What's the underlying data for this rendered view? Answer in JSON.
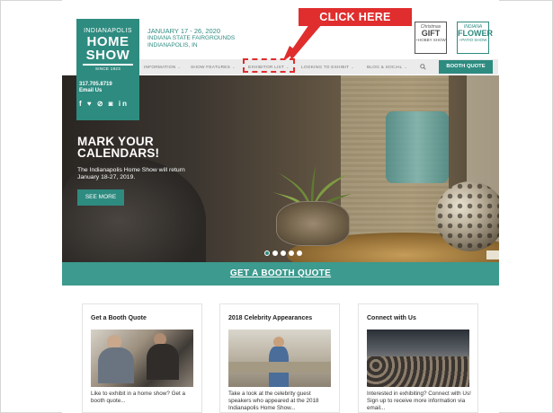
{
  "header": {
    "logo": {
      "line1": "INDIANAPOLIS",
      "line2": "HOME",
      "line3": "SHOW",
      "line4": "SINCE 1923"
    },
    "contact": {
      "phone": "317.705.8719",
      "email": "Email Us"
    },
    "socials": "f  ♥  ⊘  ◙  in",
    "event": {
      "date": "JANUARY 17 - 26, 2020",
      "venue": "INDIANA STATE FAIRGROUNDS",
      "city": "INDIANAPOLIS, IN"
    },
    "annotation": "CLICK HERE",
    "partners": [
      {
        "top": "Christmas",
        "mid": "GIFT",
        "bottom": "+HOBBY SHOW"
      },
      {
        "top": "INDIANA",
        "mid": "FLOWER",
        "bottom": "+PATIO SHOW"
      }
    ]
  },
  "nav": {
    "items": [
      {
        "label": "INFORMATION"
      },
      {
        "label": "SHOW FEATURES"
      },
      {
        "label": "EXHIBITOR LIST"
      },
      {
        "label": "LOOKING TO EXHIBIT"
      },
      {
        "label": "BLOG & SOCIAL"
      }
    ],
    "search_icon": "search-icon",
    "cta": "BOOTH QUOTE"
  },
  "hero": {
    "title_line1": "MARK YOUR",
    "title_line2": "CALENDARS!",
    "text_line1": "The Indianapolis Home Show will return",
    "text_line2": "January 18-27, 2019.",
    "button": "SEE MORE",
    "slides_total": 5,
    "active_slide": 1
  },
  "quote_bar": {
    "label": "GET A BOOTH QUOTE"
  },
  "cards": [
    {
      "title": "Get a Booth Quote",
      "text": "Like to exhibit in a home show? Get a booth quote..."
    },
    {
      "title": "2018 Celebrity Appearances",
      "text": "Take a look at the celebrity guest speakers who appeared at the 2018 Indianapolis Home Show..."
    },
    {
      "title": "Connect with Us",
      "text": "Interested in exhibiting? Connect with Us! Sign up to receive more information via email..."
    }
  ],
  "colors": {
    "brand_teal": "#2e8b80",
    "annotation_red": "#e02d2d",
    "nav_bg": "#ebebeb"
  }
}
